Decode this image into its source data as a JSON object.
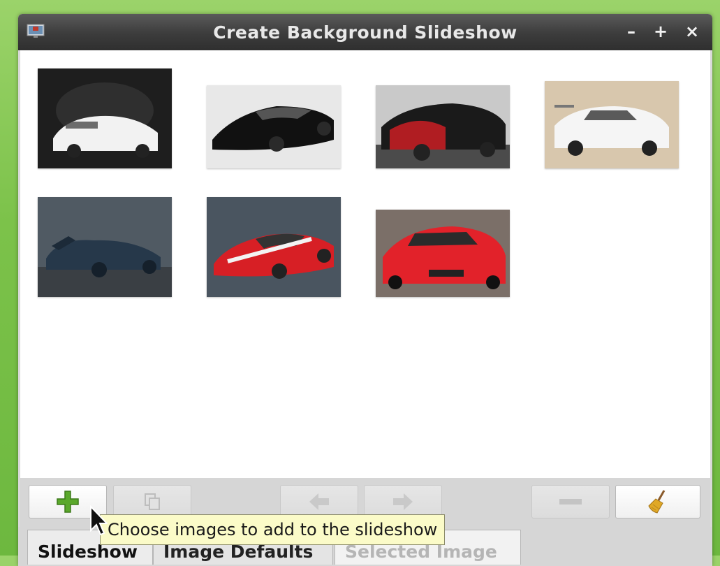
{
  "window": {
    "title": "Create Background Slideshow",
    "controls": {
      "minimize": "–",
      "maximize": "+",
      "close": "×"
    }
  },
  "thumbnails": [
    {
      "name": "thumb-white-koenigsegg",
      "bg": "#1e1e1e",
      "car": "#f2f2f2"
    },
    {
      "name": "thumb-black-lamborghini",
      "bg": "#e8e8e8",
      "car": "#111111"
    },
    {
      "name": "thumb-bugatti-veyron",
      "bg": "#c9c9c9",
      "car": "#b01d22"
    },
    {
      "name": "thumb-white-bmw",
      "bg": "#d8c7ad",
      "car": "#f5f5f5"
    },
    {
      "name": "thumb-blue-racer",
      "bg": "#505a63",
      "car": "#26384a"
    },
    {
      "name": "thumb-red-ferrari-360",
      "bg": "#4a5560",
      "car": "#d71f25"
    },
    {
      "name": "thumb-red-ferrari-599",
      "bg": "#7b6f68",
      "car": "#e2222a"
    }
  ],
  "toolbar": {
    "add_icon": "plus-icon",
    "copy_icon": "copy-icon",
    "prev_icon": "arrow-left-icon",
    "next_icon": "arrow-right-icon",
    "remove_icon": "minus-icon",
    "clear_icon": "broom-icon"
  },
  "tooltip": {
    "text": "Choose images to add to the slideshow"
  },
  "tabs": [
    {
      "label": "Slideshow"
    },
    {
      "label": "Image Defaults"
    },
    {
      "label": "Selected Image"
    }
  ],
  "colors": {
    "accent_green": "#6db83f",
    "tooltip_bg": "#fbfbc8"
  }
}
